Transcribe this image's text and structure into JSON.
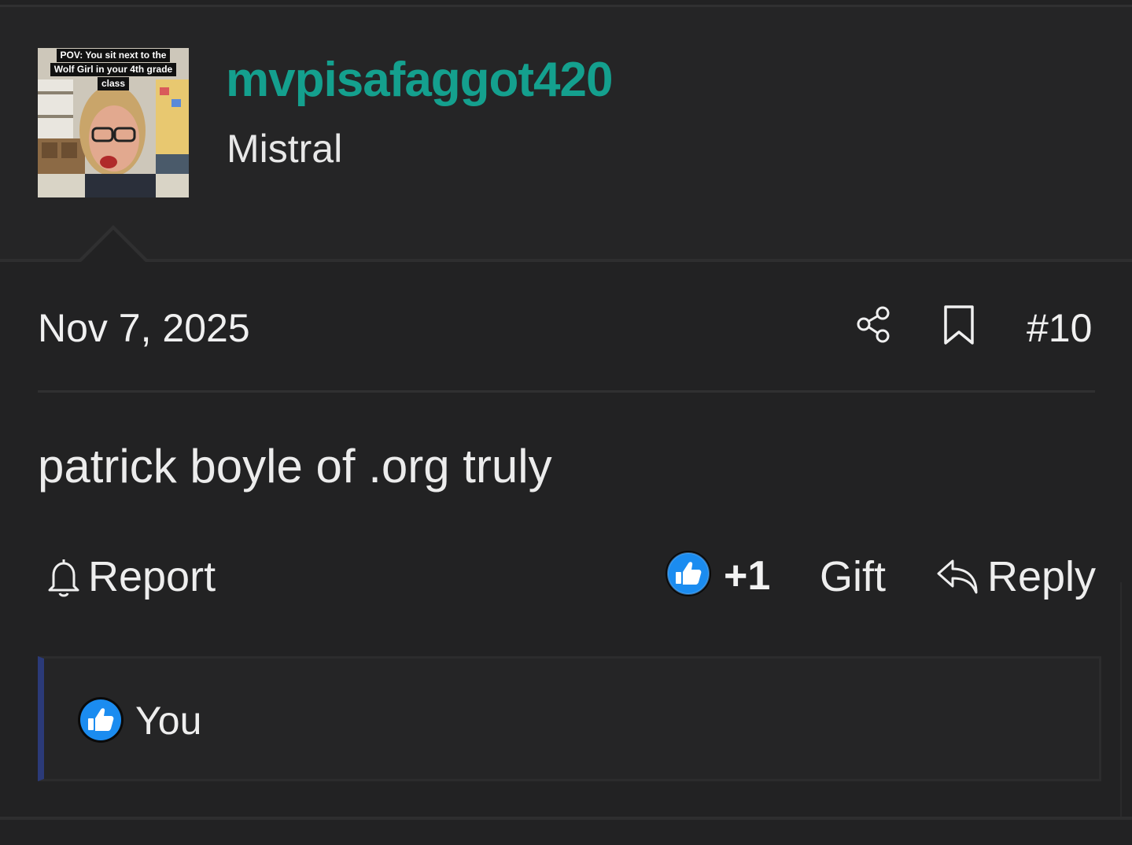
{
  "user": {
    "avatar_caption_lines": [
      "POV: You sit next to the",
      "Wolf Girl in your 4th grade",
      "class"
    ],
    "username": "mvpisafaggot420",
    "title": "Mistral"
  },
  "post": {
    "date": "Nov 7, 2025",
    "number": "#10",
    "body": "patrick boyle of .org truly"
  },
  "actions": {
    "report_label": "Report",
    "reaction_count": "+1",
    "gift_label": "Gift",
    "reply_label": "Reply"
  },
  "reactions": {
    "users": [
      "You"
    ]
  },
  "icons": {
    "share": "share-icon",
    "bookmark": "bookmark-icon",
    "report": "bell-icon",
    "like": "thumbs-up-icon",
    "reply": "reply-arrow-icon"
  },
  "colors": {
    "background": "#222223",
    "username": "#14a08e",
    "like_badge": "#1b8cf0",
    "reactions_accent": "#2b3a78"
  }
}
